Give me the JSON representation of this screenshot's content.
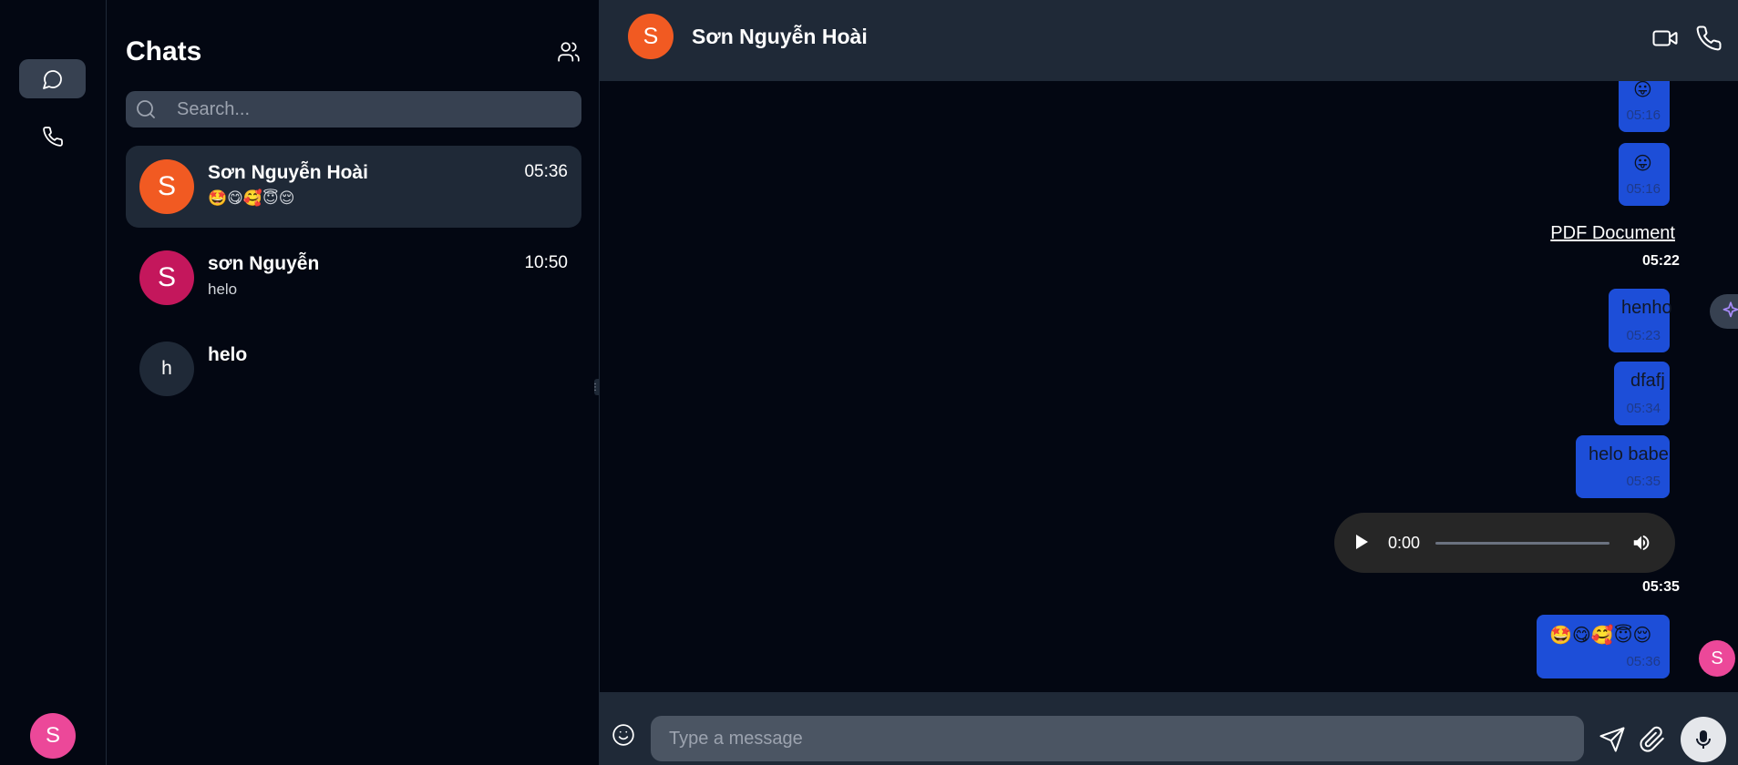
{
  "rail": {
    "items": [
      {
        "name": "chats",
        "icon": "message-circle-icon",
        "active": true
      },
      {
        "name": "calls",
        "icon": "phone-icon",
        "active": false
      }
    ],
    "user_avatar_initial": "S",
    "user_avatar_color": "#ec4899"
  },
  "panel": {
    "title": "Chats",
    "search_placeholder": "Search...",
    "chats": [
      {
        "name": "Sơn Nguyễn Hoài",
        "initial": "S",
        "color": "#f15a22",
        "time": "05:36",
        "preview": "🤩😋🥰😇😌",
        "selected": true
      },
      {
        "name": "sơn Nguyễn",
        "initial": "S",
        "color": "#c4175c",
        "time": "10:50",
        "preview": "helo",
        "selected": false
      },
      {
        "name": "helo",
        "initial": "h",
        "color": "#1f2937",
        "time": "",
        "preview": "",
        "selected": false
      }
    ]
  },
  "header": {
    "name": "Sơn Nguyễn Hoài",
    "initial": "S",
    "color": "#f15a22"
  },
  "messages": [
    {
      "type": "emoji",
      "text": "😛",
      "time": "05:16"
    },
    {
      "type": "emoji",
      "text": "😛",
      "time": "05:16"
    },
    {
      "type": "file",
      "text": "PDF Document",
      "time": "05:22"
    },
    {
      "type": "text",
      "text": "henho",
      "time": "05:23"
    },
    {
      "type": "text",
      "text": "dfafj",
      "time": "05:34"
    },
    {
      "type": "text",
      "text": "helo babe",
      "time": "05:35"
    },
    {
      "type": "audio",
      "current": "0:00",
      "time": "05:35"
    },
    {
      "type": "emoji",
      "text": "🤩😋🥰😇😌",
      "time": "05:36"
    }
  ],
  "message_avatar_initial": "S",
  "composer": {
    "placeholder": "Type a message"
  },
  "colors": {
    "bubble": "#1d4ed8",
    "header_bg": "#1f2937",
    "page_bg": "#030712"
  }
}
